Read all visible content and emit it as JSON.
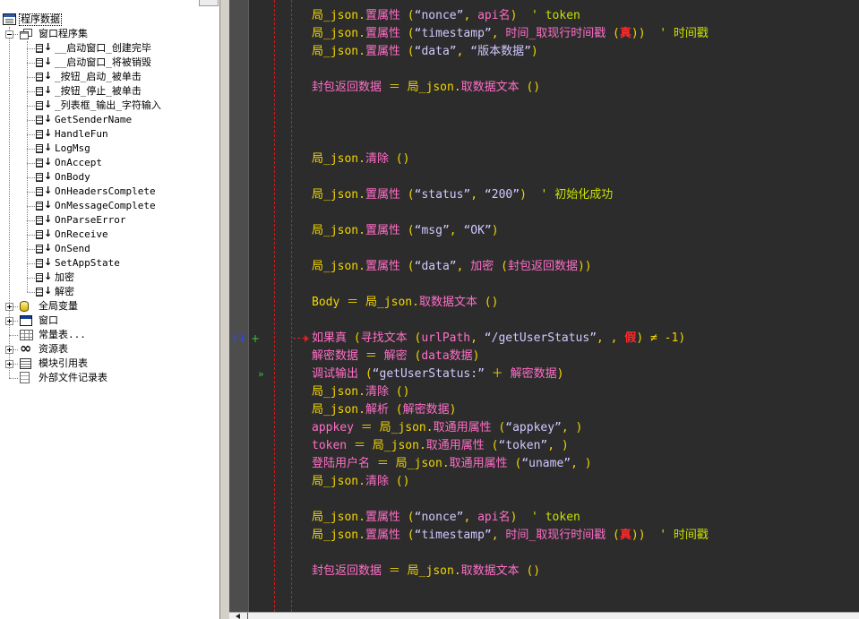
{
  "theme": {
    "variable": "#f2d600",
    "command": "#ff6ec7",
    "punct": "#f2d600",
    "string": "#d2c8ff",
    "comment": "#c8e000",
    "constant": "#ff2a2a",
    "code_bg": "#2c2c2c",
    "tree_bg": "#ffffff"
  },
  "tree": {
    "items": [
      {
        "label": "程序数据",
        "level": 0,
        "icon": "program-data-icon",
        "selected": true
      },
      {
        "label": "窗口程序集",
        "level": 1,
        "expander": "collapse",
        "icon": "assembly-icon"
      },
      {
        "label": "__启动窗口_创建完毕",
        "level": 2,
        "icon": "subroutine-icon"
      },
      {
        "label": "__启动窗口_将被销毁",
        "level": 2,
        "icon": "subroutine-icon"
      },
      {
        "label": "_按钮_启动_被单击",
        "level": 2,
        "icon": "subroutine-icon"
      },
      {
        "label": "_按钮_停止_被单击",
        "level": 2,
        "icon": "subroutine-icon"
      },
      {
        "label": "_列表框_输出_字符输入",
        "level": 2,
        "icon": "subroutine-icon"
      },
      {
        "label": "GetSenderName",
        "level": 2,
        "icon": "subroutine-icon"
      },
      {
        "label": "HandleFun",
        "level": 2,
        "icon": "subroutine-icon"
      },
      {
        "label": "LogMsg",
        "level": 2,
        "icon": "subroutine-icon"
      },
      {
        "label": "OnAccept",
        "level": 2,
        "icon": "subroutine-icon"
      },
      {
        "label": "OnBody",
        "level": 2,
        "icon": "subroutine-icon"
      },
      {
        "label": "OnHeadersComplete",
        "level": 2,
        "icon": "subroutine-icon"
      },
      {
        "label": "OnMessageComplete",
        "level": 2,
        "icon": "subroutine-icon"
      },
      {
        "label": "OnParseError",
        "level": 2,
        "icon": "subroutine-icon"
      },
      {
        "label": "OnReceive",
        "level": 2,
        "icon": "subroutine-icon"
      },
      {
        "label": "OnSend",
        "level": 2,
        "icon": "subroutine-icon"
      },
      {
        "label": "SetAppState",
        "level": 2,
        "icon": "subroutine-icon"
      },
      {
        "label": "加密",
        "level": 2,
        "icon": "subroutine-icon"
      },
      {
        "label": "解密",
        "level": 2,
        "icon": "subroutine-icon"
      },
      {
        "label": "全局变量",
        "level": 1,
        "expander": "expand",
        "icon": "global-variable-icon"
      },
      {
        "label": "窗口",
        "level": 1,
        "expander": "expand",
        "icon": "window-icon"
      },
      {
        "label": "常量表...",
        "level": 1,
        "icon": "constant-table-icon"
      },
      {
        "label": "资源表",
        "level": 1,
        "expander": "expand",
        "icon": "resource-table-icon"
      },
      {
        "label": "模块引用表",
        "level": 1,
        "expander": "expand",
        "icon": "module-reference-icon"
      },
      {
        "label": "外部文件记录表",
        "level": 1,
        "icon": "external-file-icon"
      }
    ]
  },
  "editor": {
    "lines": [
      {
        "tokens": [
          [
            "v",
            "局_json"
          ],
          [
            "p",
            "."
          ],
          [
            "m",
            "置属性"
          ],
          [
            "p",
            " ("
          ],
          [
            "s",
            "“nonce”"
          ],
          [
            "p",
            ", "
          ],
          [
            "m",
            "api名"
          ],
          [
            "p",
            ")"
          ],
          [
            "c",
            "  ' token"
          ]
        ]
      },
      {
        "tokens": [
          [
            "v",
            "局_json"
          ],
          [
            "p",
            "."
          ],
          [
            "m",
            "置属性"
          ],
          [
            "p",
            " ("
          ],
          [
            "s",
            "“timestamp”"
          ],
          [
            "p",
            ", "
          ],
          [
            "m",
            "时间_取现行时间戳"
          ],
          [
            "p",
            " ("
          ],
          [
            "k",
            "真"
          ],
          [
            "p",
            "))"
          ],
          [
            "c",
            "  ' 时间戳"
          ]
        ]
      },
      {
        "tokens": [
          [
            "v",
            "局_json"
          ],
          [
            "p",
            "."
          ],
          [
            "m",
            "置属性"
          ],
          [
            "p",
            " ("
          ],
          [
            "s",
            "“data”"
          ],
          [
            "p",
            ", "
          ],
          [
            "s",
            "“版本数据”"
          ],
          [
            "p",
            ")"
          ]
        ]
      },
      {
        "tokens": []
      },
      {
        "tokens": [
          [
            "m",
            "封包返回数据"
          ],
          [
            "p",
            " ＝ "
          ],
          [
            "v",
            "局_json"
          ],
          [
            "p",
            "."
          ],
          [
            "m",
            "取数据文本"
          ],
          [
            "p",
            " ()"
          ]
        ]
      },
      {
        "tokens": []
      },
      {
        "tokens": []
      },
      {
        "tokens": []
      },
      {
        "tokens": [
          [
            "v",
            "局_json"
          ],
          [
            "p",
            "."
          ],
          [
            "m",
            "清除"
          ],
          [
            "p",
            " ()"
          ]
        ]
      },
      {
        "tokens": []
      },
      {
        "tokens": [
          [
            "v",
            "局_json"
          ],
          [
            "p",
            "."
          ],
          [
            "m",
            "置属性"
          ],
          [
            "p",
            " ("
          ],
          [
            "s",
            "“status”"
          ],
          [
            "p",
            ", "
          ],
          [
            "s",
            "“200”"
          ],
          [
            "p",
            ")"
          ],
          [
            "c",
            "  ' 初始化成功"
          ]
        ]
      },
      {
        "tokens": []
      },
      {
        "tokens": [
          [
            "v",
            "局_json"
          ],
          [
            "p",
            "."
          ],
          [
            "m",
            "置属性"
          ],
          [
            "p",
            " ("
          ],
          [
            "s",
            "“msg”"
          ],
          [
            "p",
            ", "
          ],
          [
            "s",
            "“OK”"
          ],
          [
            "p",
            ")"
          ]
        ]
      },
      {
        "tokens": []
      },
      {
        "tokens": [
          [
            "v",
            "局_json"
          ],
          [
            "p",
            "."
          ],
          [
            "m",
            "置属性"
          ],
          [
            "p",
            " ("
          ],
          [
            "s",
            "“data”"
          ],
          [
            "p",
            ", "
          ],
          [
            "m",
            "加密"
          ],
          [
            "p",
            " ("
          ],
          [
            "m",
            "封包返回数据"
          ],
          [
            "p",
            "))"
          ]
        ]
      },
      {
        "tokens": []
      },
      {
        "tokens": [
          [
            "v",
            "Body"
          ],
          [
            "p",
            " ＝ "
          ],
          [
            "v",
            "局_json"
          ],
          [
            "p",
            "."
          ],
          [
            "m",
            "取数据文本"
          ],
          [
            "p",
            " ()"
          ]
        ]
      },
      {
        "tokens": []
      },
      {
        "tokens": [
          [
            "m",
            "如果真"
          ],
          [
            "p",
            " ("
          ],
          [
            "m",
            "寻找文本"
          ],
          [
            "p",
            " ("
          ],
          [
            "m",
            "urlPath"
          ],
          [
            "p",
            ", "
          ],
          [
            "s",
            "“/getUserStatus”"
          ],
          [
            "p",
            ", , "
          ],
          [
            "k",
            "假"
          ],
          [
            "p",
            ") ≠ -1)"
          ]
        ],
        "markers": [
          "step-arrows-icon",
          "add-breakpoint-icon",
          "flow-arrow-icon"
        ]
      },
      {
        "tokens": [
          [
            "m",
            "解密数据"
          ],
          [
            "p",
            " ＝ "
          ],
          [
            "m",
            "解密"
          ],
          [
            "p",
            " ("
          ],
          [
            "m",
            "data数据"
          ],
          [
            "p",
            ")"
          ]
        ]
      },
      {
        "tokens": [
          [
            "m",
            "调试输出"
          ],
          [
            "p",
            " ("
          ],
          [
            "s",
            "“getUserStatus:”"
          ],
          [
            "p",
            " ＋ "
          ],
          [
            "m",
            "解密数据"
          ],
          [
            "p",
            ")"
          ]
        ],
        "markers": [
          "run-arrow-icon"
        ]
      },
      {
        "tokens": [
          [
            "v",
            "局_json"
          ],
          [
            "p",
            "."
          ],
          [
            "m",
            "清除"
          ],
          [
            "p",
            " ()"
          ]
        ]
      },
      {
        "tokens": [
          [
            "v",
            "局_json"
          ],
          [
            "p",
            "."
          ],
          [
            "m",
            "解析"
          ],
          [
            "p",
            " ("
          ],
          [
            "m",
            "解密数据"
          ],
          [
            "p",
            ")"
          ]
        ]
      },
      {
        "tokens": [
          [
            "m",
            "appkey"
          ],
          [
            "p",
            " ＝ "
          ],
          [
            "v",
            "局_json"
          ],
          [
            "p",
            "."
          ],
          [
            "m",
            "取通用属性"
          ],
          [
            "p",
            " ("
          ],
          [
            "s",
            "“appkey”"
          ],
          [
            "p",
            ", )"
          ]
        ]
      },
      {
        "tokens": [
          [
            "m",
            "token"
          ],
          [
            "p",
            " ＝ "
          ],
          [
            "v",
            "局_json"
          ],
          [
            "p",
            "."
          ],
          [
            "m",
            "取通用属性"
          ],
          [
            "p",
            " ("
          ],
          [
            "s",
            "“token”"
          ],
          [
            "p",
            ", )"
          ]
        ]
      },
      {
        "tokens": [
          [
            "m",
            "登陆用户名"
          ],
          [
            "p",
            " ＝ "
          ],
          [
            "v",
            "局_json"
          ],
          [
            "p",
            "."
          ],
          [
            "m",
            "取通用属性"
          ],
          [
            "p",
            " ("
          ],
          [
            "s",
            "“uname”"
          ],
          [
            "p",
            ", )"
          ]
        ]
      },
      {
        "tokens": [
          [
            "v",
            "局_json"
          ],
          [
            "p",
            "."
          ],
          [
            "m",
            "清除"
          ],
          [
            "p",
            " ()"
          ]
        ]
      },
      {
        "tokens": []
      },
      {
        "tokens": [
          [
            "v",
            "局_json"
          ],
          [
            "p",
            "."
          ],
          [
            "m",
            "置属性"
          ],
          [
            "p",
            " ("
          ],
          [
            "s",
            "“nonce”"
          ],
          [
            "p",
            ", "
          ],
          [
            "m",
            "api名"
          ],
          [
            "p",
            ")"
          ],
          [
            "c",
            "  ' token"
          ]
        ]
      },
      {
        "tokens": [
          [
            "v",
            "局_json"
          ],
          [
            "p",
            "."
          ],
          [
            "m",
            "置属性"
          ],
          [
            "p",
            " ("
          ],
          [
            "s",
            "“timestamp”"
          ],
          [
            "p",
            ", "
          ],
          [
            "m",
            "时间_取现行时间戳"
          ],
          [
            "p",
            " ("
          ],
          [
            "k",
            "真"
          ],
          [
            "p",
            "))"
          ],
          [
            "c",
            "  ' 时间戳"
          ]
        ]
      },
      {
        "tokens": []
      },
      {
        "tokens": [
          [
            "m",
            "封包返回数据"
          ],
          [
            "p",
            " ＝ "
          ],
          [
            "v",
            "局_json"
          ],
          [
            "p",
            "."
          ],
          [
            "m",
            "取数据文本"
          ],
          [
            "p",
            " ()"
          ]
        ]
      }
    ]
  }
}
